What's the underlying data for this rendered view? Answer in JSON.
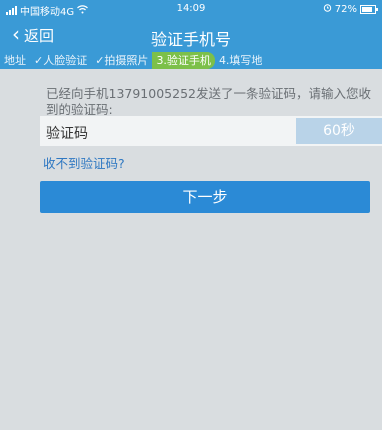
{
  "status_bar": {
    "carrier": "中国移动4G",
    "time": "14:09",
    "battery": "72%"
  },
  "header": {
    "back_label": "返回",
    "title": "验证手机号"
  },
  "steps": [
    {
      "label": "地址",
      "state": "done"
    },
    {
      "label": "✓人脸验证",
      "state": "done"
    },
    {
      "label": "✓拍摄照片",
      "state": "done"
    },
    {
      "label": "3.验证手机",
      "state": "active"
    },
    {
      "label": "4.填写地",
      "state": "pending"
    }
  ],
  "main": {
    "prompt": "已经向手机13791005252发送了一条验证码，请输入您收到的验证码:",
    "code_label": "验证码",
    "countdown": "60秒",
    "no_code_link": "收不到验证码?",
    "next_button": "下一步"
  }
}
